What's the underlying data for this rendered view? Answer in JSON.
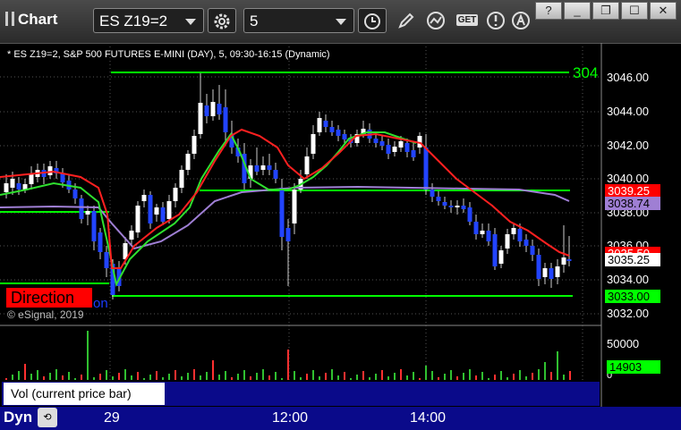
{
  "window": {
    "title": "Chart",
    "minimize": "_",
    "restore": "❐",
    "close": "✕",
    "pin": "?"
  },
  "toolbar": {
    "symbol": "ES Z19=2",
    "interval": "5",
    "settings_icon": "gear-icon",
    "get_label": "GET"
  },
  "chart": {
    "header": "* ES Z19=2, S&P 500 FUTURES E-MINI (DAY), 5, 09:30-16:15 (Dynamic)",
    "line_label_partial": "304",
    "price_axis": [
      "3046.00",
      "3044.00",
      "3042.00",
      "3040.00",
      "3038.00",
      "3036.00",
      "3034.00",
      "3032.00"
    ],
    "tags": [
      {
        "text": "3039.25",
        "bg": "#ff0000",
        "fg": "#ffffff"
      },
      {
        "text": "3038.74",
        "bg": "#9f7fd4",
        "fg": "#000000"
      },
      {
        "text": "3035.25",
        "bg": "#ffffff",
        "fg": "#000000"
      },
      {
        "text": "3035.50",
        "bg": "#ff0000",
        "fg": "#ffffff"
      },
      {
        "text": "3033.00",
        "bg": "#00ff00",
        "fg": "#000000"
      }
    ],
    "direction_label": "Direction",
    "direction_suffix": "on",
    "copyright": "© eSignal, 2019",
    "x_labels": [
      "29",
      "12:00",
      "14:00"
    ]
  },
  "volume": {
    "label": "Vol (current price bar)",
    "close": "x",
    "scale_top": "50000",
    "scale_mid": "0",
    "current": "14903"
  },
  "bottom": {
    "mode": "Dyn",
    "fit_icon": "fit-icon"
  }
}
